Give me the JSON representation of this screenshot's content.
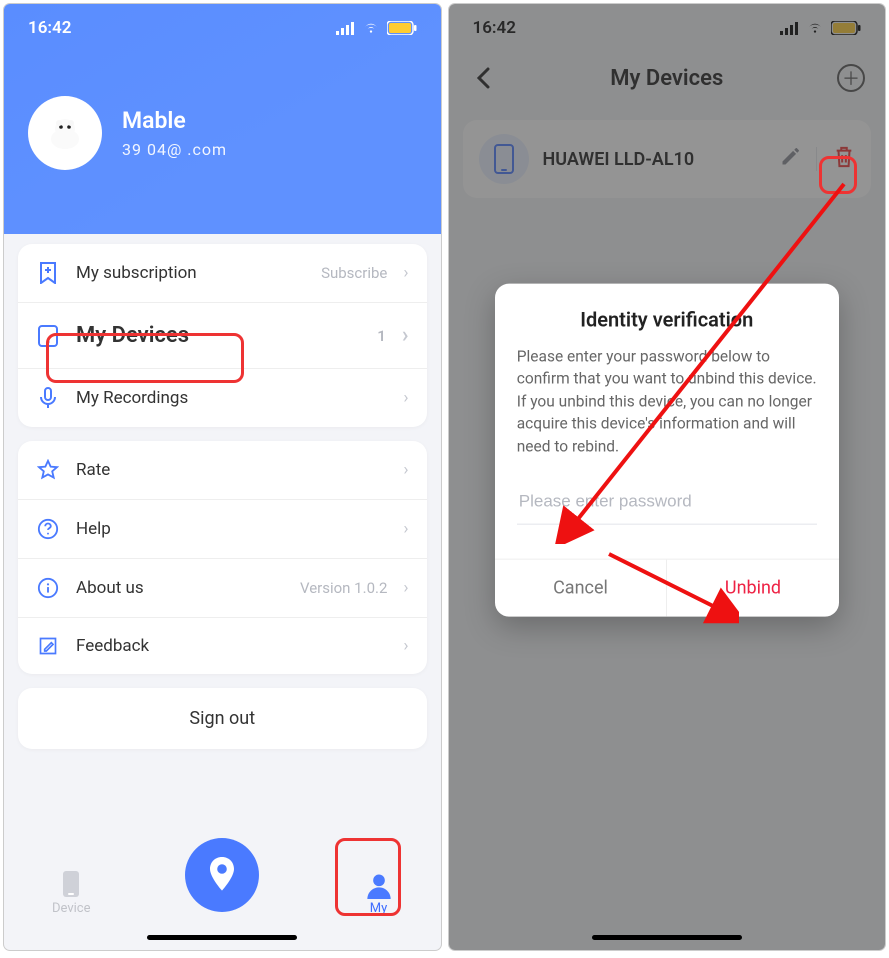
{
  "screen1": {
    "time": "16:42",
    "profile": {
      "name": "Mable",
      "email": "39     04@   .com"
    },
    "menu": {
      "subscription": {
        "label": "My subscription",
        "action": "Subscribe"
      },
      "devices": {
        "label": "My Devices",
        "count": "1"
      },
      "recordings": {
        "label": "My Recordings"
      },
      "rate": {
        "label": "Rate"
      },
      "help": {
        "label": "Help"
      },
      "about": {
        "label": "About us",
        "version": "Version 1.0.2"
      },
      "feedback": {
        "label": "Feedback"
      }
    },
    "signout": "Sign out",
    "tabs": {
      "device": "Device",
      "my": "My"
    }
  },
  "screen2": {
    "time": "16:42",
    "title": "My Devices",
    "device": {
      "name": "HUAWEI LLD-AL10"
    },
    "dialog": {
      "title": "Identity verification",
      "message": "Please enter your password below to confirm that you want to unbind this device. If you unbind this device, you can no longer acquire this device's information and will need to rebind.",
      "placeholder": "Please enter password",
      "cancel": "Cancel",
      "confirm": "Unbind"
    }
  }
}
